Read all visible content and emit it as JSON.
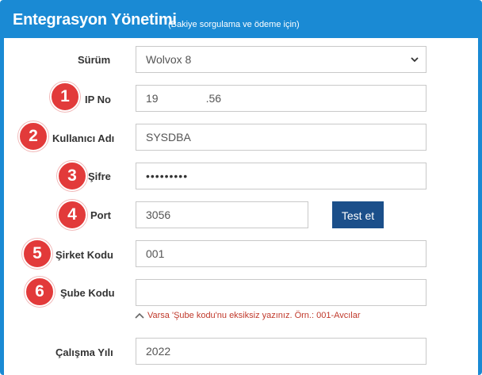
{
  "header": {
    "title": "Entegrasyon Yönetimi",
    "subtitle": "(Bakiye sorgulama ve ödeme için)"
  },
  "form": {
    "surum": {
      "label": "Sürüm",
      "value": "Wolvox 8"
    },
    "ip": {
      "label": "IP No",
      "value_prefix": "19",
      "value_suffix": ".56",
      "badge": "1"
    },
    "kullanici": {
      "label": "Kullanıcı Adı",
      "value": "SYSDBA",
      "badge": "2"
    },
    "sifre": {
      "label": "Şifre",
      "value": "•••••••••",
      "badge": "3"
    },
    "port": {
      "label": "Port",
      "value": "3056",
      "badge": "4",
      "test_button": "Test et"
    },
    "sirket": {
      "label": "Şirket Kodu",
      "value": "001",
      "badge": "5"
    },
    "sube": {
      "label": "Şube Kodu",
      "value": "",
      "badge": "6",
      "hint": "Varsa 'Şube kodu'nu eksiksiz yazınız. Örn.: 001-Avcılar"
    },
    "calisma": {
      "label": "Çalışma Yılı",
      "value": "2022"
    }
  },
  "colors": {
    "header": "#1a8ad4",
    "badge": "#e23a3a",
    "button": "#1b4f8a",
    "hint": "#c0392b"
  },
  "icons": {
    "select_arrow": "chevron-down-icon",
    "hint_arrow": "chevron-up-icon"
  }
}
